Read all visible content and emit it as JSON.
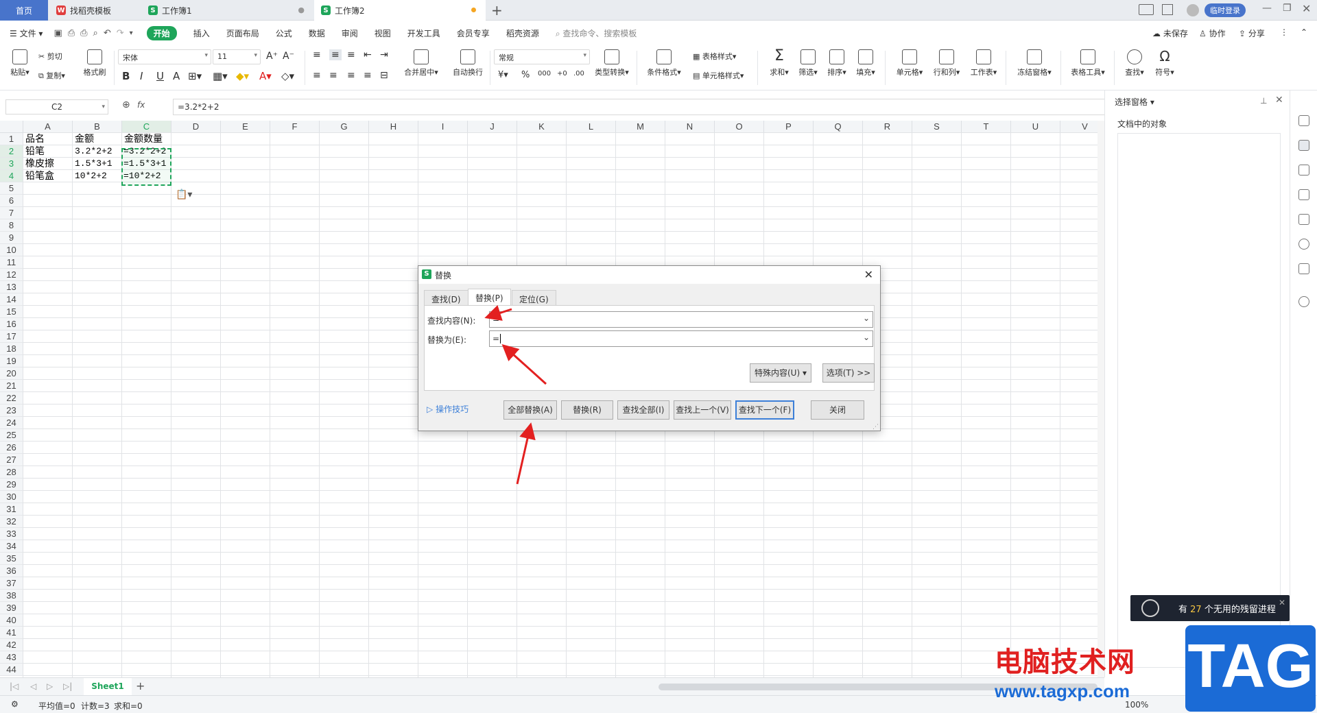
{
  "tabs": [
    {
      "label": "首页"
    },
    {
      "label": "找稻壳模板"
    },
    {
      "label": "工作簿1"
    },
    {
      "label": "工作簿2"
    }
  ],
  "topright": {
    "login": "临时登录"
  },
  "menu": {
    "file": "文件",
    "items": [
      "开始",
      "插入",
      "页面布局",
      "公式",
      "数据",
      "审阅",
      "视图",
      "开发工具",
      "会员专享",
      "稻壳资源"
    ],
    "search": "查找命令、搜索模板",
    "unsaved": "未保存",
    "collab": "协作",
    "share": "分享"
  },
  "ribbon": {
    "paste": "粘贴",
    "cut": "剪切",
    "copy": "复制",
    "format_painter": "格式刷",
    "font": "宋体",
    "size": "11",
    "merge": "合并居中",
    "wrap": "自动换行",
    "numfmt": "常规",
    "convert": "类型转换",
    "cond": "条件格式",
    "table_style": "表格样式",
    "cell_style": "单元格样式",
    "sum": "求和",
    "filter": "筛选",
    "sort": "排序",
    "fill": "填充",
    "cell": "单元格",
    "rowcol": "行和列",
    "sheet": "工作表",
    "freeze": "冻结窗格",
    "table_tools": "表格工具",
    "find": "查找",
    "symbol": "符号"
  },
  "formula_bar": {
    "namebox": "C2",
    "fx": "fx",
    "formula": "=3.2*2+2"
  },
  "columns": [
    "A",
    "B",
    "C",
    "D",
    "E",
    "F",
    "G",
    "H",
    "I",
    "J",
    "K",
    "L",
    "M",
    "N",
    "O",
    "P",
    "Q",
    "R",
    "S",
    "T",
    "U",
    "V"
  ],
  "rows": [
    "1",
    "2",
    "3",
    "4",
    "5",
    "6",
    "7",
    "8",
    "9",
    "10",
    "11",
    "12",
    "13",
    "14",
    "15",
    "16",
    "17",
    "18",
    "19",
    "20",
    "21",
    "22",
    "23",
    "24",
    "25",
    "26",
    "27",
    "28",
    "29",
    "30",
    "31",
    "32",
    "33",
    "34",
    "35",
    "36",
    "37",
    "38",
    "39",
    "40",
    "41",
    "42",
    "43",
    "44"
  ],
  "cells": {
    "A1": "品名",
    "B1": "金额",
    "C1": "金额数量",
    "A2": "铅笔",
    "B2": "3.2*2+2",
    "C2": "=3.2*2+2",
    "A3": "橡皮擦",
    "B3": "1.5*3+1",
    "C3": "=1.5*3+1",
    "A4": "铅笔盒",
    "B4": "10*2+2",
    "C4": "=10*2+2"
  },
  "sheet_tab": "Sheet1",
  "status": {
    "avg": "平均值=0",
    "count": "计数=3",
    "sum": "求和=0",
    "zoom": "100%"
  },
  "side_panel": {
    "title": "选择窗格",
    "subtitle": "文档中的对象"
  },
  "dialog": {
    "title": "替换",
    "tabs": [
      "查找(D)",
      "替换(P)",
      "定位(G)"
    ],
    "find_label": "查找内容(N):",
    "find_value": "=",
    "replace_label": "替换为(E):",
    "replace_value": "=",
    "special_btn": "特殊内容(U)",
    "options_btn": "选项(T) >>",
    "tips": "操作技巧",
    "buttons": [
      "全部替换(A)",
      "替换(R)",
      "查找全部(I)",
      "查找上一个(V)",
      "查找下一个(F)",
      "关闭"
    ]
  },
  "toast": {
    "prefix": "有",
    "num": "27",
    "suffix": "个无用的残留进程"
  },
  "watermark": {
    "text": "电脑技术网",
    "tag": "TAG",
    "url": "www.tagxp.com"
  }
}
